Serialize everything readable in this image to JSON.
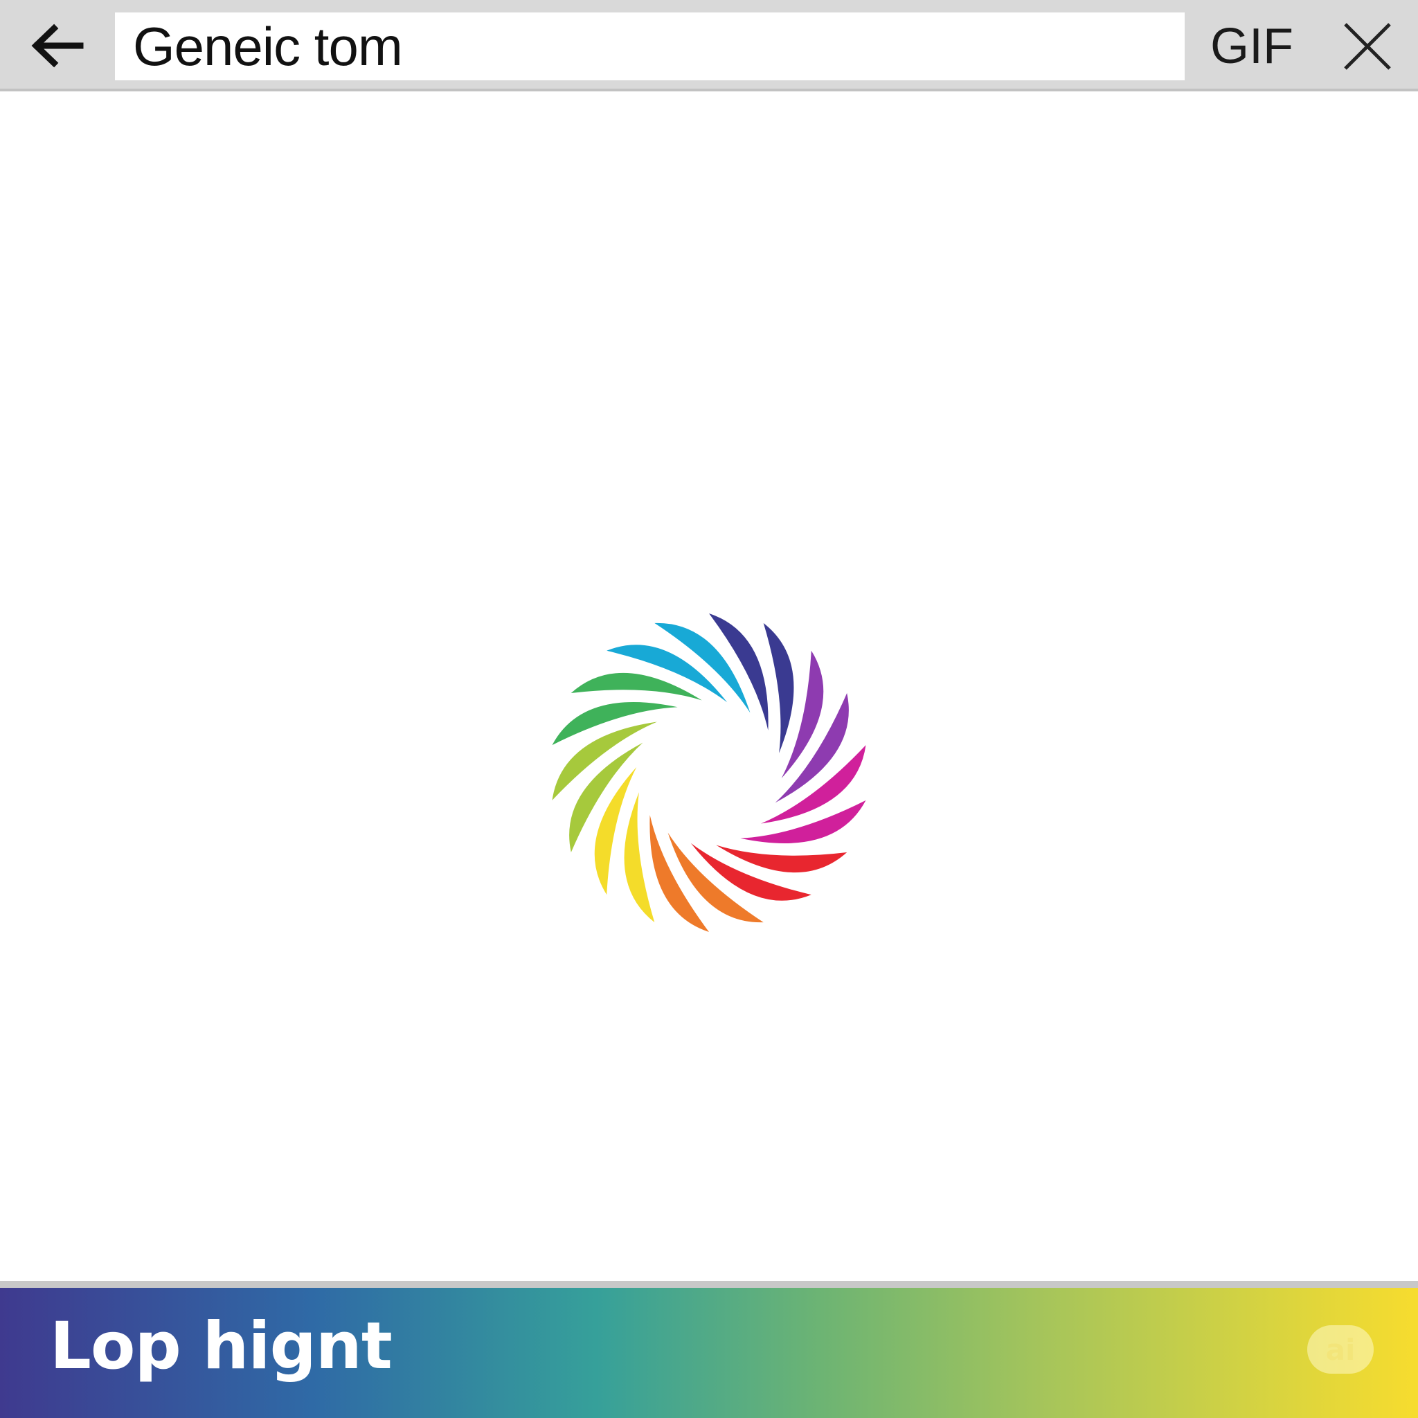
{
  "toolbar": {
    "back_icon": "arrow-left-icon",
    "search_value": "Geneic tom",
    "gif_label": "GIF",
    "close_icon": "close-icon"
  },
  "content": {
    "logo": "rainbow-swirl-logo",
    "logo_colors": [
      "#3a3a91",
      "#8e3bb0",
      "#d0209b",
      "#e8262f",
      "#ee7a2a",
      "#f4dc2a",
      "#a6c93c",
      "#3fb25a",
      "#18a9d6"
    ]
  },
  "banner": {
    "title": "Lop hignt",
    "badge": "ai",
    "gradient": [
      "#3f3a8f",
      "#2f6aa6",
      "#36a09a",
      "#6db473",
      "#a7c55a",
      "#d9d43f",
      "#f7dc2e"
    ]
  }
}
